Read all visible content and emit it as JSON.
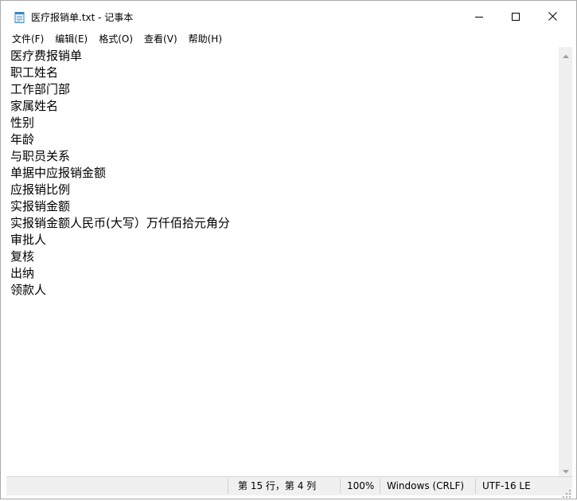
{
  "window": {
    "title": "医疗报销单.txt - 记事本"
  },
  "menu": [
    {
      "label": "文件(F)"
    },
    {
      "label": "编辑(E)"
    },
    {
      "label": "格式(O)"
    },
    {
      "label": "查看(V)"
    },
    {
      "label": "帮助(H)"
    }
  ],
  "document": {
    "lines": [
      "医疗费报销单",
      "职工姓名",
      "工作部门部",
      "家属姓名",
      "性别",
      "年龄",
      "与职员关系",
      "单据中应报销金额",
      "应报销比例",
      "实报销金额",
      "实报销金额人民币(大写）万仟佰拾元角分",
      "审批人",
      "复核",
      "出纳",
      "领款人"
    ]
  },
  "status": {
    "position": "第 15 行，第 4 列",
    "zoom": "100%",
    "line_ending": "Windows (CRLF)",
    "encoding": "UTF-16 LE"
  },
  "icons": {
    "app": "notepad-icon",
    "minimize": "minimize-icon",
    "maximize": "maximize-icon",
    "close": "close-icon"
  }
}
